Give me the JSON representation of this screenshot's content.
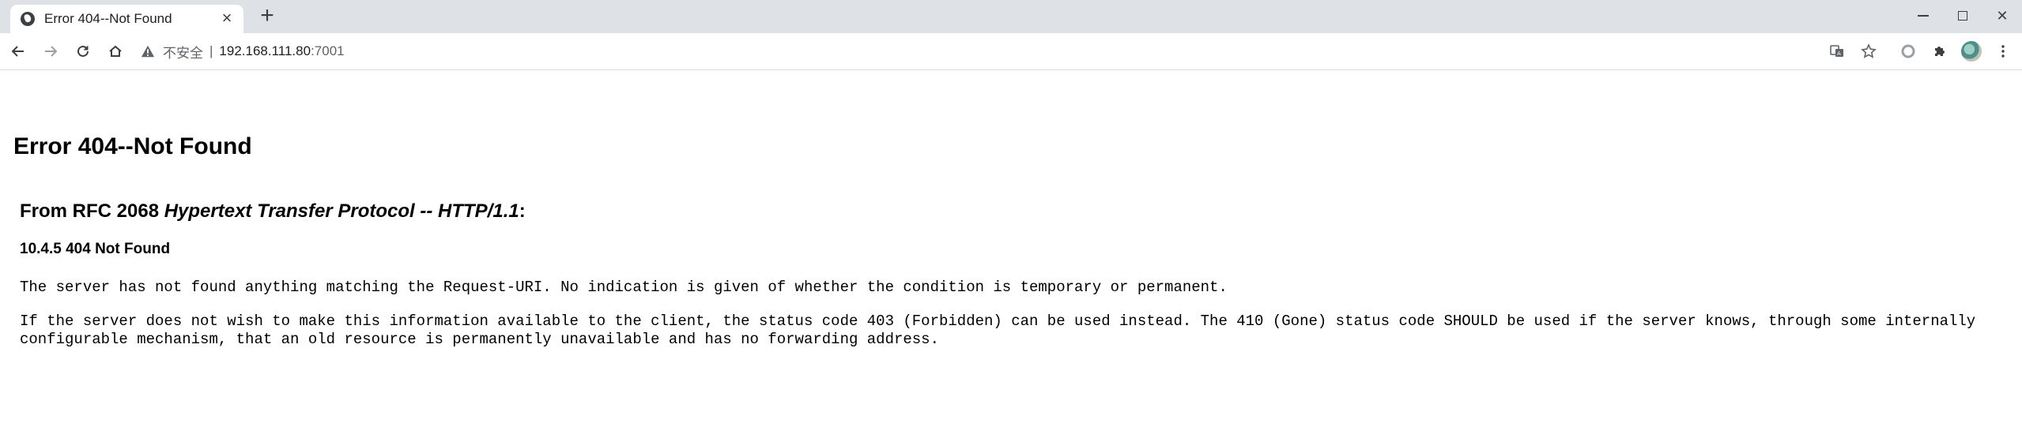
{
  "browser": {
    "tab": {
      "title": "Error 404--Not Found",
      "close_glyph": "×",
      "favicon": "globe-icon"
    },
    "new_tab_glyph": "+",
    "window_controls": {
      "close_glyph": "✕"
    },
    "address": {
      "security_label": "不安全",
      "separator": "|",
      "host": "192.168.111.80",
      "port": ":7001"
    },
    "toolbar_icons": [
      "back-arrow-icon",
      "forward-arrow-icon",
      "reload-icon",
      "home-icon",
      "translate-icon",
      "star-icon",
      "extension-circle-icon",
      "puzzle-icon",
      "avatar",
      "more-vert-icon"
    ]
  },
  "page": {
    "title": "Error 404--Not Found",
    "rfc_prefix": "From RFC 2068 ",
    "rfc_italic": "Hypertext Transfer Protocol -- HTTP/1.1",
    "rfc_suffix": ":",
    "section": "10.4.5 404 Not Found",
    "para1": "The server has not found anything matching the Request-URI. No indication is given of whether the condition is temporary or permanent.",
    "para2": "If the server does not wish to make this information available to the client, the status code 403 (Forbidden) can be used instead. The 410 (Gone) status code SHOULD be used if the server knows, through some internally configurable mechanism, that an old resource is permanently unavailable and has no forwarding address."
  }
}
